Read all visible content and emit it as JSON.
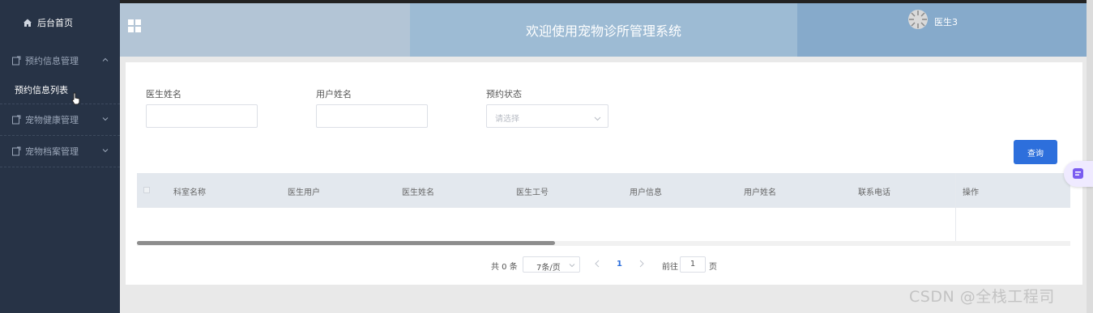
{
  "sidebar": {
    "home_label": "后台首页",
    "groups": [
      {
        "label": "预约信息管理",
        "expanded": true,
        "items": [
          {
            "label": "预约信息列表"
          }
        ]
      },
      {
        "label": "宠物健康管理",
        "expanded": false
      },
      {
        "label": "宠物档案管理",
        "expanded": false
      }
    ]
  },
  "header": {
    "title": "欢迎使用宠物诊所管理系统",
    "username": "医生3"
  },
  "search": {
    "doctor_name_label": "医生姓名",
    "user_name_label": "用户姓名",
    "status_label": "预约状态",
    "status_placeholder": "请选择",
    "query_button": "查询"
  },
  "table": {
    "columns": [
      "科室名称",
      "医生用户",
      "医生姓名",
      "医生工号",
      "用户信息",
      "用户姓名",
      "联系电话"
    ],
    "action_column": "操作",
    "rows": []
  },
  "pagination": {
    "total_text": "共 0 条",
    "page_size": "7条/页",
    "current_page": "1",
    "goto_label": "前往",
    "goto_value": "1",
    "page_suffix": "页"
  },
  "watermark": "CSDN @全栈工程司",
  "colors": {
    "sidebar": "#273346",
    "primary": "#2d6fdc",
    "header": "#9dbbd4"
  }
}
